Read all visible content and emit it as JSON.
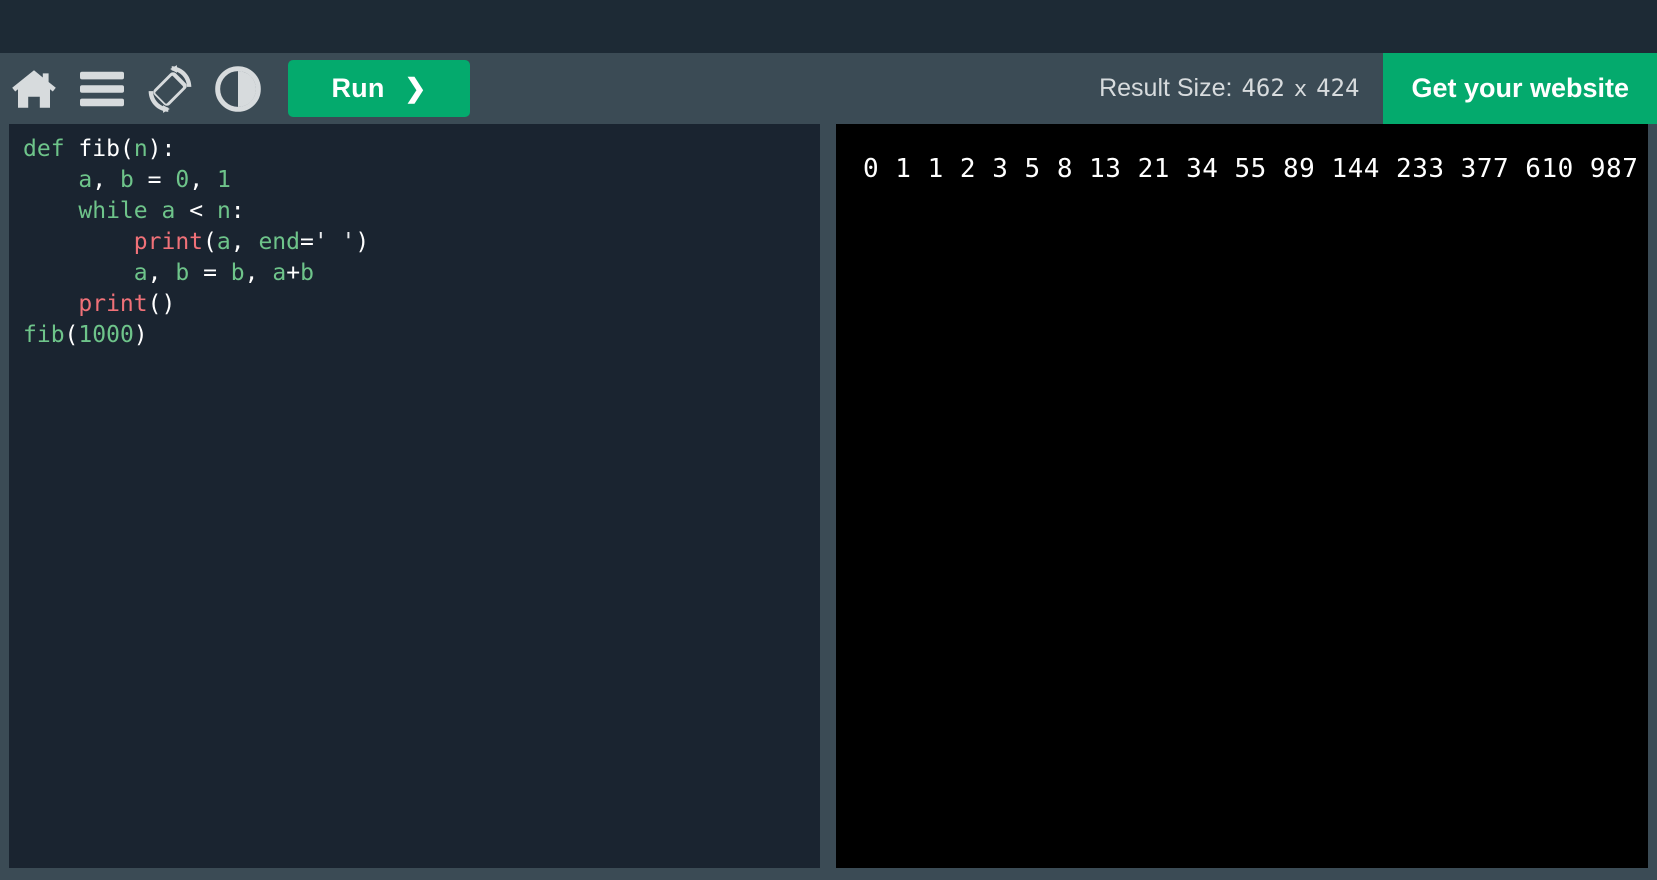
{
  "theme": {
    "top_strip_color": "#1d2a35",
    "toolbar_color": "#3b4b55",
    "accent_green": "#04aa6d",
    "editor_bg": "#1a2430",
    "output_bg": "#000000",
    "icon_color": "#d7dbdd"
  },
  "toolbar": {
    "icons": [
      {
        "name": "home-icon",
        "label": "Home"
      },
      {
        "name": "menu-icon",
        "label": "Menu"
      },
      {
        "name": "rotate-screen-icon",
        "label": "Change Orientation"
      },
      {
        "name": "contrast-icon",
        "label": "Change Theme"
      }
    ],
    "run_label": "Run",
    "run_chevron": "❯",
    "result_size_label": "Result Size:",
    "result_width": "462",
    "result_separator": "x",
    "result_height": "424",
    "get_website_label": "Get your website"
  },
  "editor": {
    "language": "python",
    "lines": [
      [
        {
          "t": "def",
          "c": "tok-kw"
        },
        {
          "t": " ",
          "c": "tok-punct"
        },
        {
          "t": "fib",
          "c": "tok-name"
        },
        {
          "t": "(",
          "c": "tok-punct"
        },
        {
          "t": "n",
          "c": "tok-var"
        },
        {
          "t": ")",
          "c": "tok-punct"
        },
        {
          "t": ":",
          "c": "tok-punct"
        }
      ],
      [
        {
          "t": "    ",
          "c": "tok-punct"
        },
        {
          "t": "a",
          "c": "tok-var"
        },
        {
          "t": ", ",
          "c": "tok-punct"
        },
        {
          "t": "b",
          "c": "tok-var"
        },
        {
          "t": " ",
          "c": "tok-punct"
        },
        {
          "t": "=",
          "c": "tok-op"
        },
        {
          "t": " ",
          "c": "tok-punct"
        },
        {
          "t": "0",
          "c": "tok-num"
        },
        {
          "t": ", ",
          "c": "tok-punct"
        },
        {
          "t": "1",
          "c": "tok-num"
        }
      ],
      [
        {
          "t": "    ",
          "c": "tok-punct"
        },
        {
          "t": "while",
          "c": "tok-kw"
        },
        {
          "t": " ",
          "c": "tok-punct"
        },
        {
          "t": "a",
          "c": "tok-var"
        },
        {
          "t": " ",
          "c": "tok-punct"
        },
        {
          "t": "<",
          "c": "tok-op"
        },
        {
          "t": " ",
          "c": "tok-punct"
        },
        {
          "t": "n",
          "c": "tok-var"
        },
        {
          "t": ":",
          "c": "tok-punct"
        }
      ],
      [
        {
          "t": "        ",
          "c": "tok-punct"
        },
        {
          "t": "print",
          "c": "tok-fn"
        },
        {
          "t": "(",
          "c": "tok-punct"
        },
        {
          "t": "a",
          "c": "tok-var"
        },
        {
          "t": ", ",
          "c": "tok-punct"
        },
        {
          "t": "end",
          "c": "tok-var"
        },
        {
          "t": "=",
          "c": "tok-op"
        },
        {
          "t": "' '",
          "c": "tok-str"
        },
        {
          "t": ")",
          "c": "tok-punct"
        }
      ],
      [
        {
          "t": "        ",
          "c": "tok-punct"
        },
        {
          "t": "a",
          "c": "tok-var"
        },
        {
          "t": ", ",
          "c": "tok-punct"
        },
        {
          "t": "b",
          "c": "tok-var"
        },
        {
          "t": " ",
          "c": "tok-punct"
        },
        {
          "t": "=",
          "c": "tok-op"
        },
        {
          "t": " ",
          "c": "tok-punct"
        },
        {
          "t": "b",
          "c": "tok-var"
        },
        {
          "t": ", ",
          "c": "tok-punct"
        },
        {
          "t": "a",
          "c": "tok-var"
        },
        {
          "t": "+",
          "c": "tok-op"
        },
        {
          "t": "b",
          "c": "tok-var"
        }
      ],
      [
        {
          "t": "    ",
          "c": "tok-punct"
        },
        {
          "t": "print",
          "c": "tok-fn"
        },
        {
          "t": "(",
          "c": "tok-punct"
        },
        {
          "t": ")",
          "c": "tok-punct"
        }
      ],
      [
        {
          "t": "fib",
          "c": "tok-var"
        },
        {
          "t": "(",
          "c": "tok-punct"
        },
        {
          "t": "1000",
          "c": "tok-num"
        },
        {
          "t": ")",
          "c": "tok-punct"
        }
      ]
    ],
    "plain_text": "def fib(n):\n    a, b = 0, 1\n    while a < n:\n        print(a, end=' ')\n        a, b = b, a+b\n    print()\nfib(1000)"
  },
  "output": {
    "text": "0 1 1 2 3 5 8 13 21 34 55 89 144 233 377 610 987",
    "values": [
      0,
      1,
      1,
      2,
      3,
      5,
      8,
      13,
      21,
      34,
      55,
      89,
      144,
      233,
      377,
      610,
      987
    ]
  }
}
